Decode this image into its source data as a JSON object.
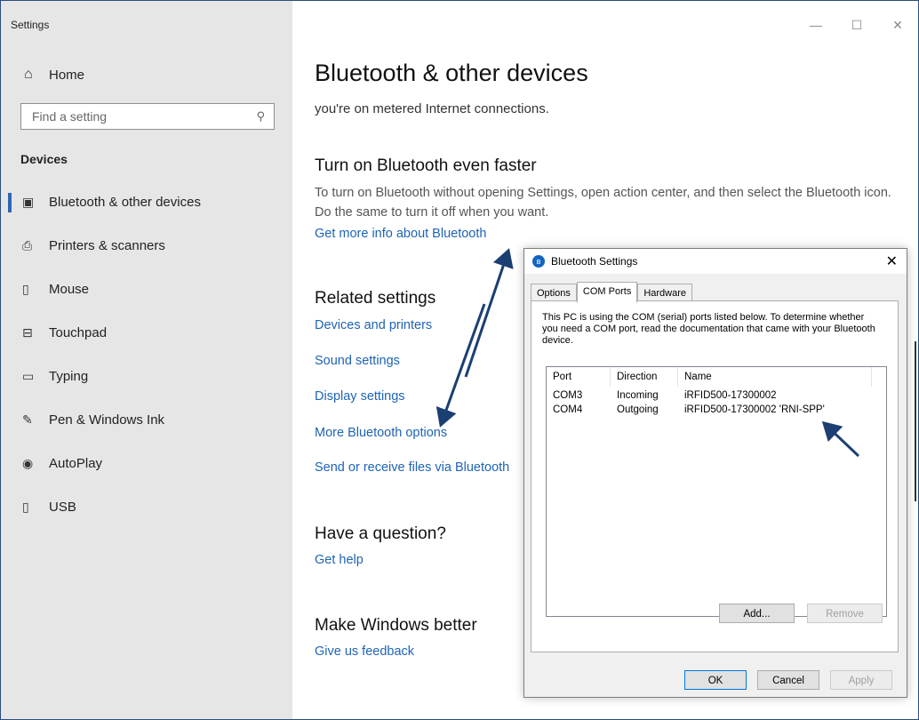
{
  "window": {
    "app_title": "Settings",
    "controls": {
      "minimize": "—",
      "maximize": "☐",
      "close": "✕"
    }
  },
  "sidebar": {
    "home_label": "Home",
    "search_placeholder": "Find a setting",
    "section_label": "Devices",
    "items": [
      {
        "label": "Bluetooth & other devices",
        "icon": "bluetooth-devices-icon",
        "selected": true
      },
      {
        "label": "Printers & scanners",
        "icon": "printer-icon"
      },
      {
        "label": "Mouse",
        "icon": "mouse-icon"
      },
      {
        "label": "Touchpad",
        "icon": "touchpad-icon"
      },
      {
        "label": "Typing",
        "icon": "keyboard-icon"
      },
      {
        "label": "Pen & Windows Ink",
        "icon": "pen-icon"
      },
      {
        "label": "AutoPlay",
        "icon": "autoplay-icon"
      },
      {
        "label": "USB",
        "icon": "usb-icon"
      }
    ]
  },
  "main": {
    "title": "Bluetooth & other devices",
    "partial_text": "you're on metered Internet connections.",
    "faster": {
      "heading": "Turn on Bluetooth even faster",
      "body": "To turn on Bluetooth without opening Settings, open action center, and then select the Bluetooth icon. Do the same to turn it off when you want.",
      "link": "Get more info about Bluetooth"
    },
    "related": {
      "heading": "Related settings",
      "links": [
        "Devices and printers",
        "Sound settings",
        "Display settings",
        "More Bluetooth options",
        "Send or receive files via Bluetooth"
      ]
    },
    "question": {
      "heading": "Have a question?",
      "link": "Get help"
    },
    "better": {
      "heading": "Make Windows better",
      "link": "Give us feedback"
    }
  },
  "dialog": {
    "title": "Bluetooth Settings",
    "close": "✕",
    "tabs": [
      "Options",
      "COM Ports",
      "Hardware"
    ],
    "active_tab": "COM Ports",
    "description": "This PC is using the COM (serial) ports listed below. To determine whether you need a COM port, read the documentation that came with your Bluetooth device.",
    "columns": [
      "Port",
      "Direction",
      "Name"
    ],
    "rows": [
      {
        "port": "COM3",
        "direction": "Incoming",
        "name": "iRFID500-17300002"
      },
      {
        "port": "COM4",
        "direction": "Outgoing",
        "name": "iRFID500-17300002 'RNI-SPP'"
      }
    ],
    "add_button": "Add...",
    "remove_button": "Remove",
    "ok_button": "OK",
    "cancel_button": "Cancel",
    "apply_button": "Apply"
  },
  "colors": {
    "accent": "#1e63b5",
    "arrow": "#1b3f72",
    "sidebar_bg": "#e6e6e6"
  }
}
